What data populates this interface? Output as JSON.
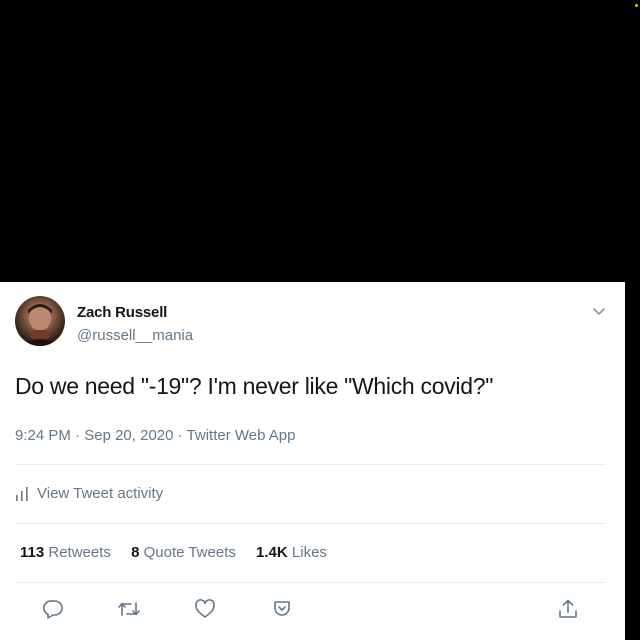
{
  "tweet": {
    "author_name": "Zach Russell",
    "author_handle": "@russell__mania",
    "text": "Do we need \"-19\"? I'm never like \"Which covid?\"",
    "time": "9:24 PM",
    "date": "Sep 20, 2020",
    "separator": " · ",
    "source": "Twitter Web App",
    "activity_label": "View Tweet activity",
    "stats": {
      "retweets_count": "113",
      "retweets_label": "Retweets",
      "quotes_count": "8",
      "quotes_label": "Quote Tweets",
      "likes_count": "1.4K",
      "likes_label": "Likes"
    }
  },
  "icons": {
    "caret": "chevron-down-icon",
    "activity": "bar-chart-icon",
    "reply": "reply-icon",
    "retweet": "retweet-icon",
    "like": "heart-icon",
    "bookmark": "bookmark-icon",
    "share": "share-icon"
  },
  "colors": {
    "background": "#000000",
    "card": "#ffffff",
    "text": "#14171a",
    "secondary_text": "#657786",
    "divider": "#e6ecf0"
  }
}
